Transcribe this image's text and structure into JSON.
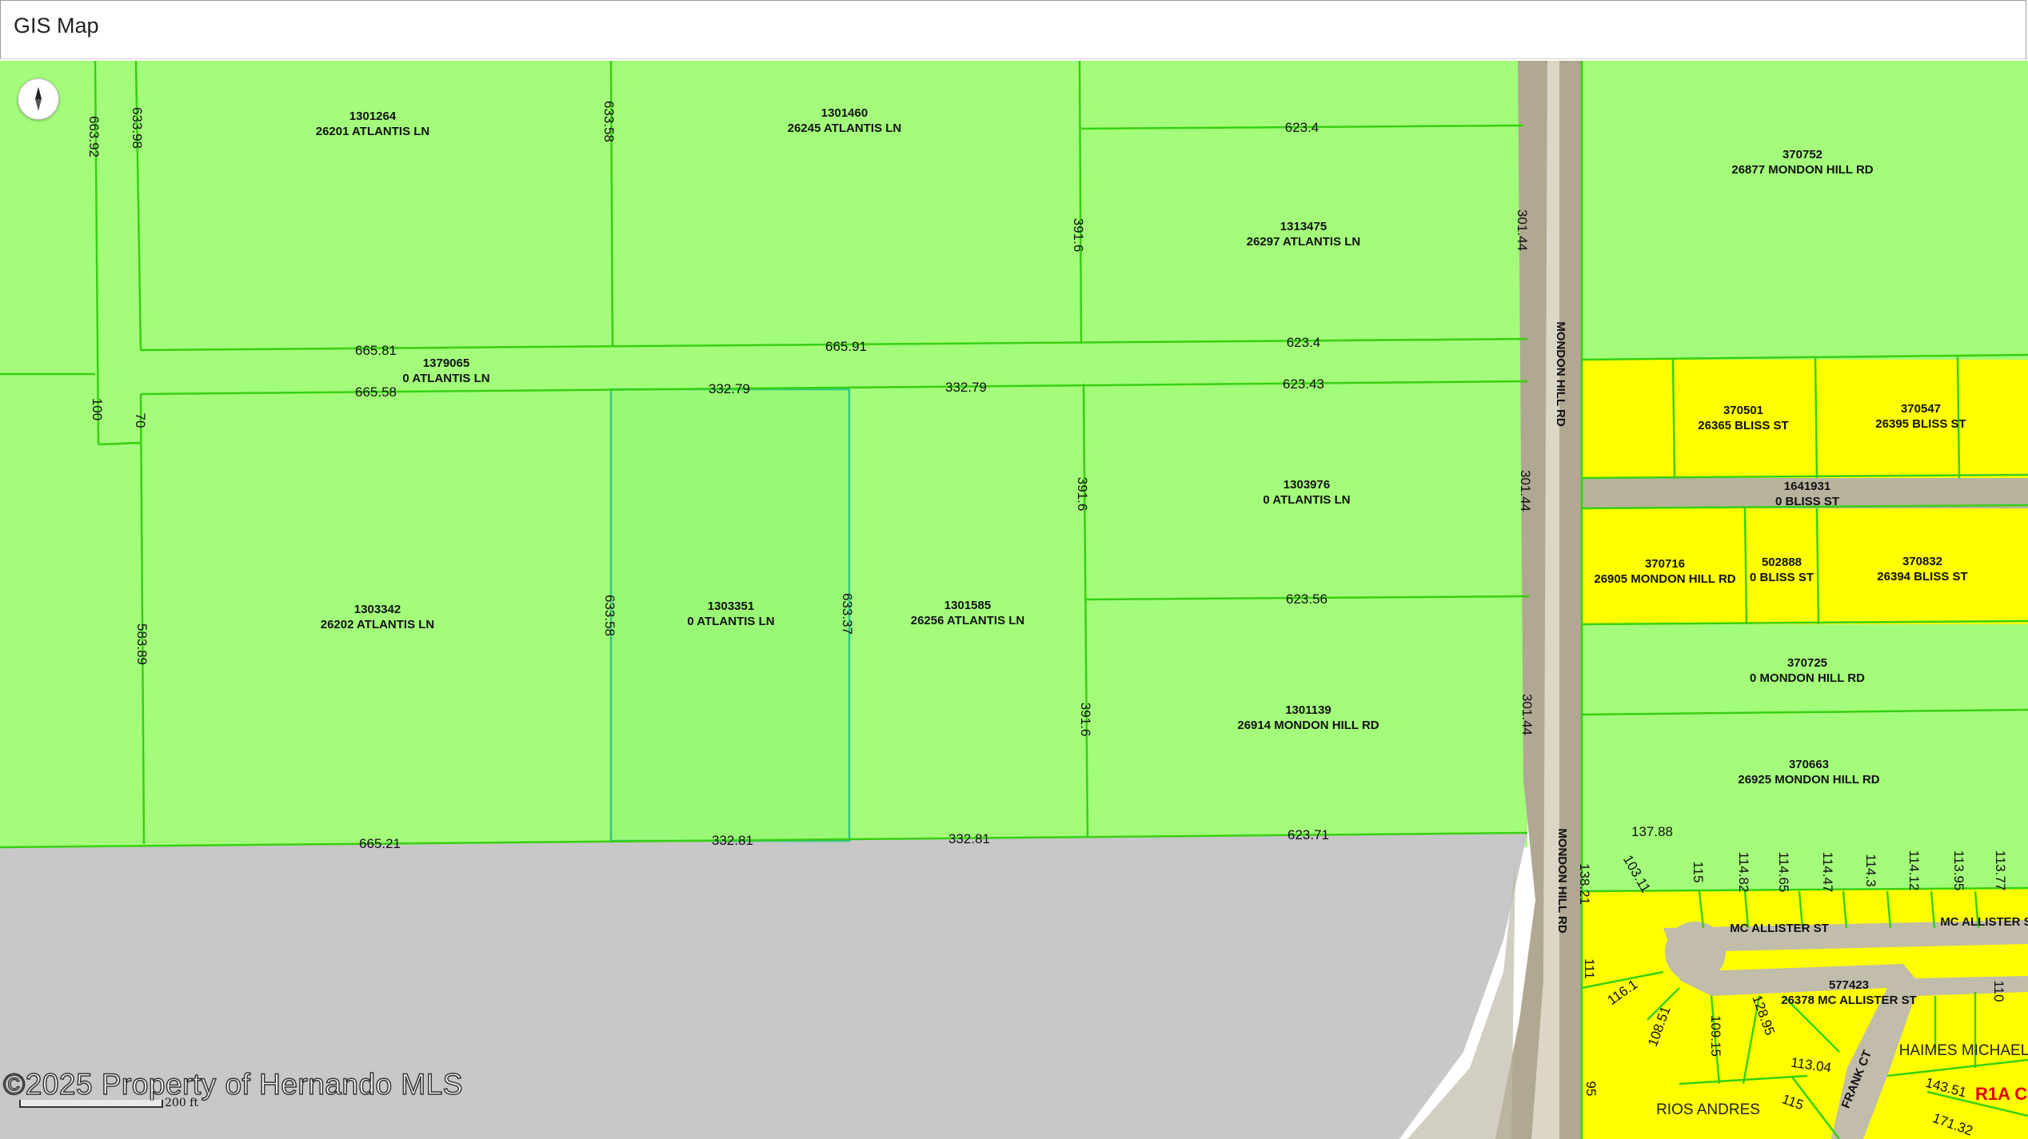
{
  "header": {
    "title": "GIS Map"
  },
  "watermark": "©2025 Property of Hernando MLS",
  "scale": {
    "label": "200 ft"
  },
  "icons": {
    "compass": "compass-icon"
  },
  "colors": {
    "agricultural": "#a3fd7a",
    "residential": "#ffff00",
    "selected": "#99f976",
    "unzoned": "#c8c8c8",
    "parcel_line": "#38d010",
    "zone_label": "#e00000"
  },
  "parcels": [
    {
      "id": "1301264",
      "address": "26201 ATLANTIS LN"
    },
    {
      "id": "1301460",
      "address": "26245 ATLANTIS LN"
    },
    {
      "id": "1313475",
      "address": "26297 ATLANTIS LN"
    },
    {
      "id": "1379065",
      "address": "0 ATLANTIS LN"
    },
    {
      "id": "1303976",
      "address": "0 ATLANTIS LN"
    },
    {
      "id": "1303342",
      "address": "26202 ATLANTIS LN"
    },
    {
      "id": "1303351",
      "address": "0 ATLANTIS LN"
    },
    {
      "id": "1301585",
      "address": "26256 ATLANTIS LN"
    },
    {
      "id": "1301139",
      "address": "26914 MONDON HILL RD"
    },
    {
      "id": "370752",
      "address": "26877 MONDON HILL RD"
    },
    {
      "id": "370501",
      "address": "26365 BLISS ST"
    },
    {
      "id": "370547",
      "address": "26395 BLISS ST"
    },
    {
      "id": "1641931",
      "address": "0 BLISS ST"
    },
    {
      "id": "370716",
      "address": "26905 MONDON HILL RD"
    },
    {
      "id": "502888",
      "address": "0 BLISS ST"
    },
    {
      "id": "370832",
      "address": "26394 BLISS ST"
    },
    {
      "id": "370725",
      "address": "0 MONDON HILL RD"
    },
    {
      "id": "370663",
      "address": "26925 MONDON HILL RD"
    },
    {
      "id": "577423",
      "address": "26378 MC ALLISTER ST"
    }
  ],
  "roads": [
    "MONDON HILL RD",
    "MONDON HILL RD",
    "MC ALLISTER ST",
    "MC ALLISTER ST",
    "FRANK CT"
  ],
  "dimensions": [
    "663.92",
    "633.98",
    "633.58",
    "623.4",
    "391.6",
    "301.44",
    "665.81",
    "665.91",
    "623.4",
    "665.58",
    "332.79",
    "332.79",
    "623.43",
    "100",
    "70",
    "391.6",
    "301.44",
    "623.56",
    "583.89",
    "633.58",
    "633.37",
    "391.6",
    "301.44",
    "665.21",
    "332.81",
    "332.81",
    "623.71",
    "137.88",
    "138.21",
    "103.11",
    "115",
    "114.82",
    "114.65",
    "114.47",
    "114.3",
    "114.12",
    "113.95",
    "113.77",
    "111",
    "116.1",
    "108.51",
    "109.15",
    "128.95",
    "113.04",
    "143.51",
    "115",
    "171.32",
    "110",
    "95"
  ],
  "owners": [
    "HAIMES MICHAEL",
    "RIOS ANDRES"
  ],
  "zone_label": "R1A C"
}
